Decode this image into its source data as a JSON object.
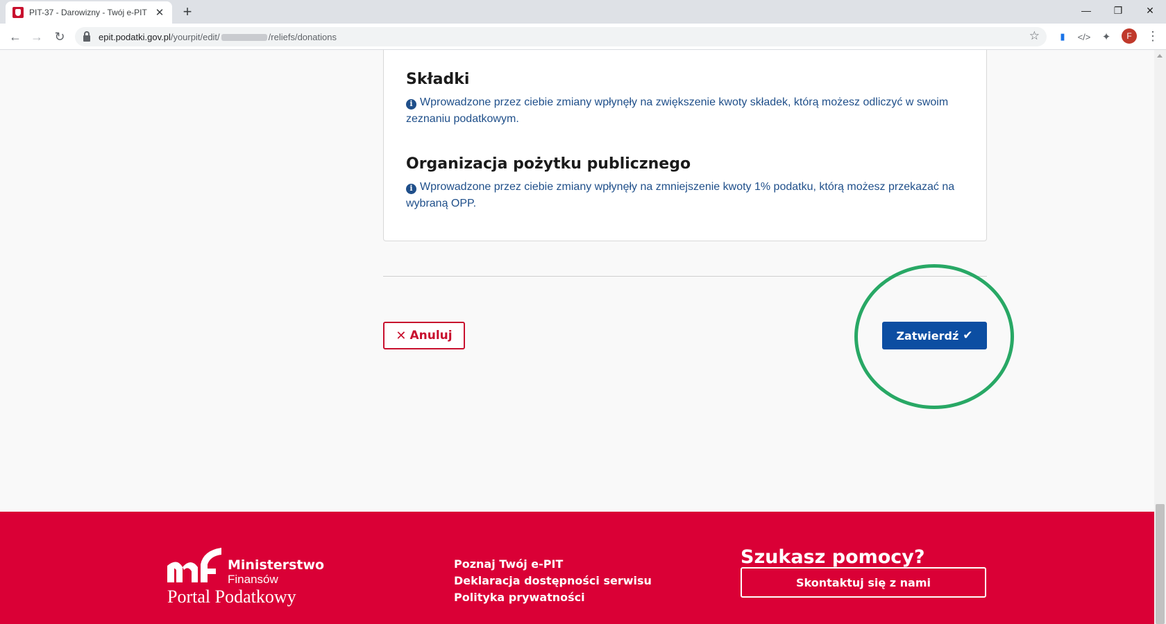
{
  "browser": {
    "tab_title": "PIT-37 - Darowizny - Twój e-PIT",
    "url_host": "epit.podatki.gov.pl",
    "url_path_prefix": "/yourpit/edit/",
    "url_path_suffix": "/reliefs/donations",
    "profile_initial": "F"
  },
  "sections": [
    {
      "title": "Składki",
      "info": "Wprowadzone przez ciebie zmiany wpłynęły na zwiększenie kwoty składek, którą możesz odliczyć w swoim zeznaniu podatkowym."
    },
    {
      "title": "Organizacja pożytku publicznego",
      "info": "Wprowadzone przez ciebie zmiany wpłynęły na zmniejszenie kwoty 1% podatku, którą możesz przekazać na wybraną OPP."
    }
  ],
  "actions": {
    "cancel_label": "Anuluj",
    "confirm_label": "Zatwierdź"
  },
  "footer": {
    "ministry_name": "Ministerstwo",
    "ministry_sub": "Finansów",
    "portal_name": "Portal Podatkowy",
    "links": [
      "Poznaj Twój e-PIT",
      "Deklaracja dostępności serwisu",
      "Polityka prywatności"
    ],
    "help_title": "Szukasz pomocy?",
    "contact_label": "Skontaktuj się z nami"
  },
  "colors": {
    "primary_blue": "#0c4ea2",
    "accent_red": "#da0036",
    "highlight_green": "#28a865"
  }
}
